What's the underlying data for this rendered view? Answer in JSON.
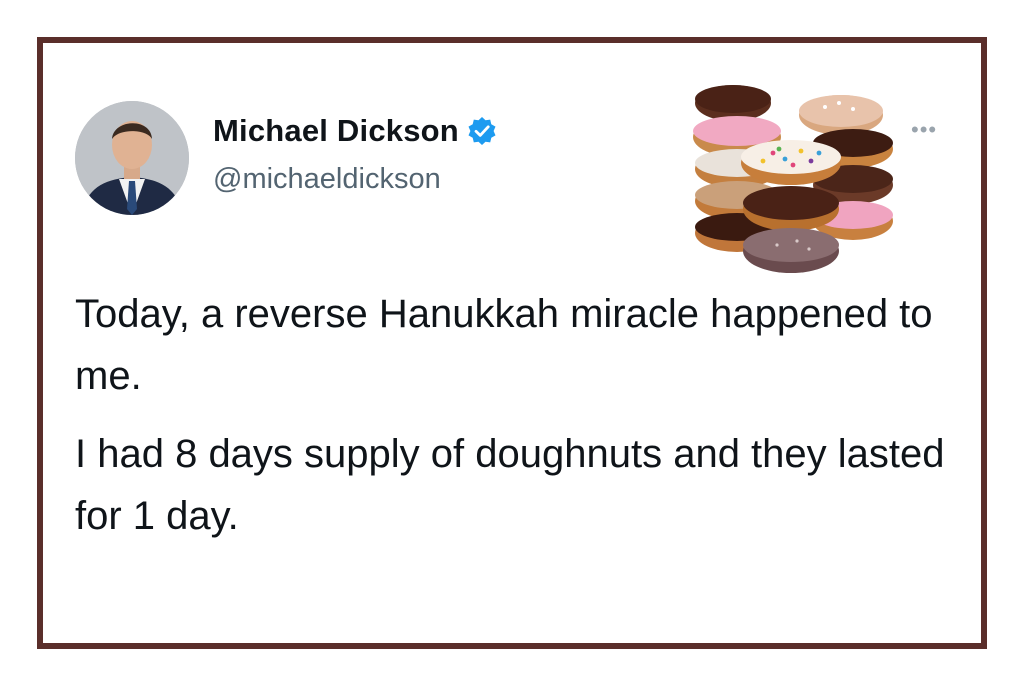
{
  "tweet": {
    "author": {
      "display_name": "Michael Dickson",
      "handle": "@michaeldickson",
      "verified": true
    },
    "paragraphs": [
      "Today, a reverse Hanukkah miracle happened to me.",
      "I had 8 days supply of doughnuts and they lasted for 1 day."
    ]
  },
  "icons": {
    "verified": "verified-badge-icon",
    "more": "more-options-icon"
  },
  "colors": {
    "frame": "#5a2e2a",
    "verified_badge": "#1d9bf0",
    "name_text": "#0f1419",
    "handle_text": "#536471"
  }
}
